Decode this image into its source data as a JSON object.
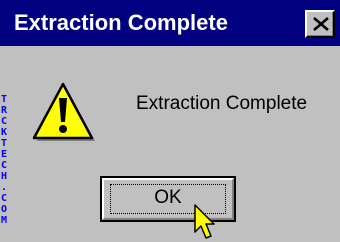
{
  "window": {
    "title": "Extraction Complete"
  },
  "titlebar": {
    "close_icon": "close-x-icon"
  },
  "dialog": {
    "icon": "warning-triangle-icon",
    "message": "Extraction Complete"
  },
  "buttons": {
    "ok_label": "OK"
  },
  "watermark": {
    "text": "TRCKTECH.COM"
  },
  "colors": {
    "titlebar": "#000080",
    "face": "#c0c0c0",
    "warning": "#ffff00",
    "watermark": "#0000ff"
  }
}
